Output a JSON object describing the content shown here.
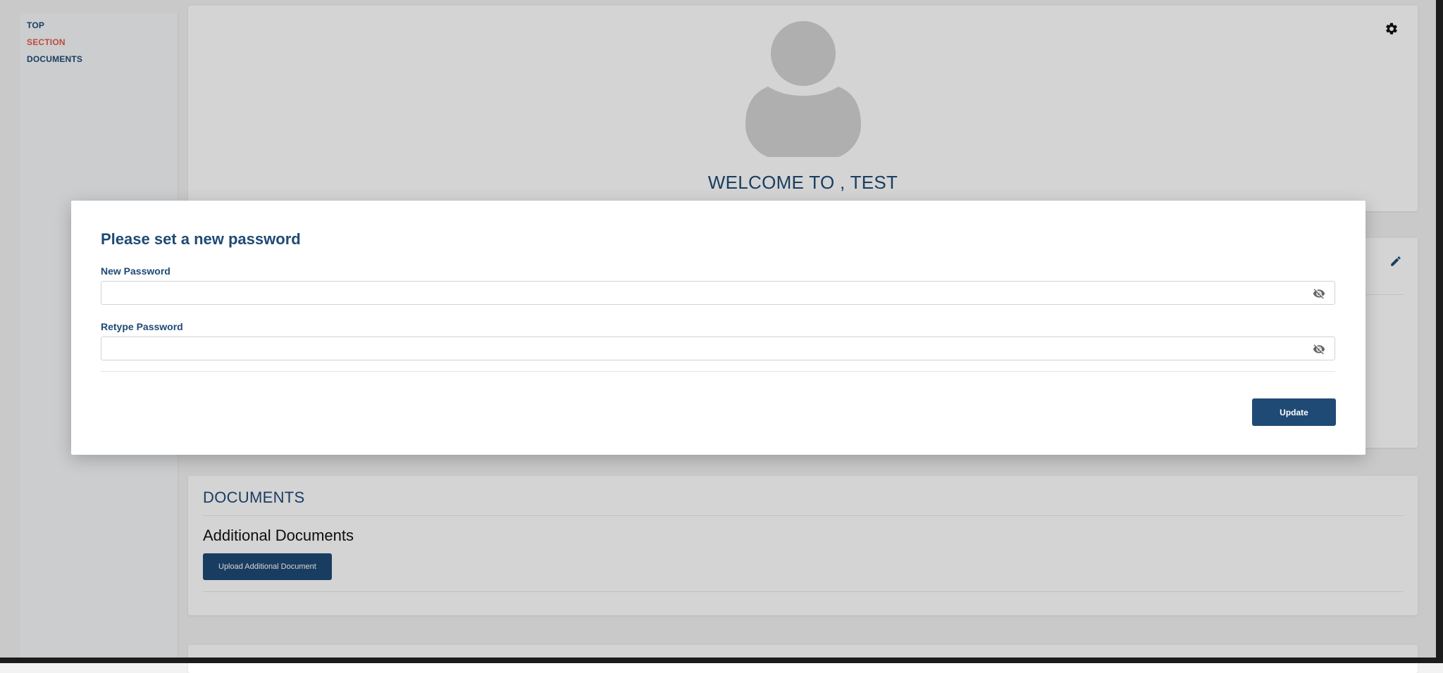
{
  "sidebar": {
    "items": [
      {
        "label": "TOP"
      },
      {
        "label": "SECTION"
      },
      {
        "label": "DOCUMENTS"
      }
    ]
  },
  "hero": {
    "welcome": "WELCOME TO , TEST"
  },
  "documents": {
    "title": "DOCUMENTS",
    "subtitle": "Additional Documents",
    "upload_label": "Upload Additional Document"
  },
  "modal": {
    "title": "Please set a new password",
    "new_password_label": "New Password",
    "new_password_value": "",
    "retype_password_label": "Retype Password",
    "retype_password_value": "",
    "update_label": "Update"
  },
  "icons": {
    "settings": "gear-icon",
    "edit": "pencil-icon",
    "avatar": "user-avatar-icon",
    "visibility": "eye-off-icon"
  },
  "colors": {
    "primary": "#1f4a75",
    "active_nav": "#e45b4b",
    "overlay": "rgba(0,0,0,0.17)"
  }
}
